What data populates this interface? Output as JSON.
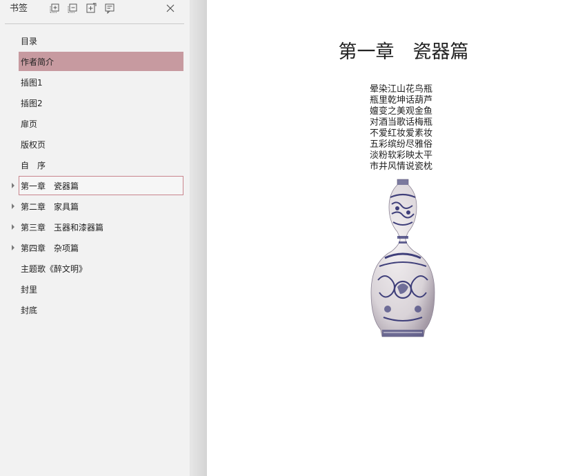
{
  "sidebar": {
    "title": "书签",
    "tools": [
      {
        "name": "add-bookmark-icon"
      },
      {
        "name": "delete-bookmark-icon"
      },
      {
        "name": "expand-bookmark-icon"
      },
      {
        "name": "bookmark-properties-icon"
      }
    ],
    "close_icon": "close-icon",
    "items": [
      {
        "label": "目录",
        "expandable": false
      },
      {
        "label": "作者简介",
        "expandable": false,
        "selected": true
      },
      {
        "label": "插图1",
        "expandable": false
      },
      {
        "label": "插图2",
        "expandable": false
      },
      {
        "label": "扉页",
        "expandable": false
      },
      {
        "label": "版权页",
        "expandable": false
      },
      {
        "label": "自　序",
        "expandable": false
      },
      {
        "label": "第一章　瓷器篇",
        "expandable": true,
        "focused": true
      },
      {
        "label": "第二章　家具篇",
        "expandable": true
      },
      {
        "label": "第三章　玉器和漆器篇",
        "expandable": true
      },
      {
        "label": "第四章　杂项篇",
        "expandable": true
      },
      {
        "label": "主题歌《醉文明》",
        "expandable": false
      },
      {
        "label": "封里",
        "expandable": false
      },
      {
        "label": "封底",
        "expandable": false
      }
    ]
  },
  "page": {
    "chapter_title": "第一章　瓷器篇",
    "poem": [
      "晕染江山花鸟瓶",
      "瓶里乾坤话葫芦",
      "嬗变之美观金鱼",
      "对酒当歌话梅瓶",
      "不爱红妆爱素妆",
      "五彩缤纷尽雅俗",
      "淡粉软彩映太平",
      "市井风情说瓷枕"
    ]
  },
  "colors": {
    "sidebar_bg": "#f2f2f2",
    "selected_bg": "#c79aa0",
    "focus_border": "#c8848c",
    "porcelain_blue": "#3f3f7a"
  }
}
